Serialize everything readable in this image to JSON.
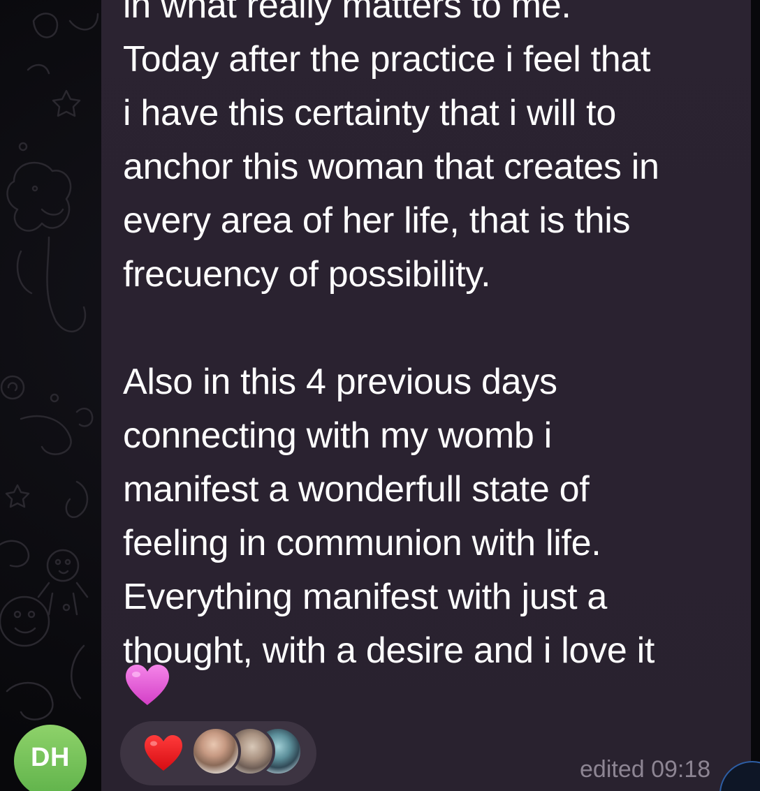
{
  "message": {
    "lines": [
      "in what really matters to me.",
      "Today after the practice i feel that",
      "i have this certainty that i will to",
      "anchor this woman that creates in",
      "every area of her life, that is this",
      "frecuency of possibility.",
      "",
      "Also in this 4 previous days",
      "connecting with my womb i",
      "manifest a wonderfull state of",
      "feeling in communion with life.",
      "Everything manifest with just a",
      "thought, with a desire and i love it"
    ],
    "trailing_emoji": "pink-heart-emoji",
    "status_text": "edited 09:18"
  },
  "reactions": {
    "emoji": "red-heart-emoji",
    "reactor_count": 3
  },
  "sender": {
    "initials": "DH",
    "avatar_color": "#6cc152"
  },
  "colors": {
    "bubble": "#2a2230",
    "text": "#ffffff",
    "meta": "#8d8593",
    "reaction_pill": "#3d3442",
    "heart_red": "#e8141c",
    "heart_pink": "#e85bd8"
  }
}
